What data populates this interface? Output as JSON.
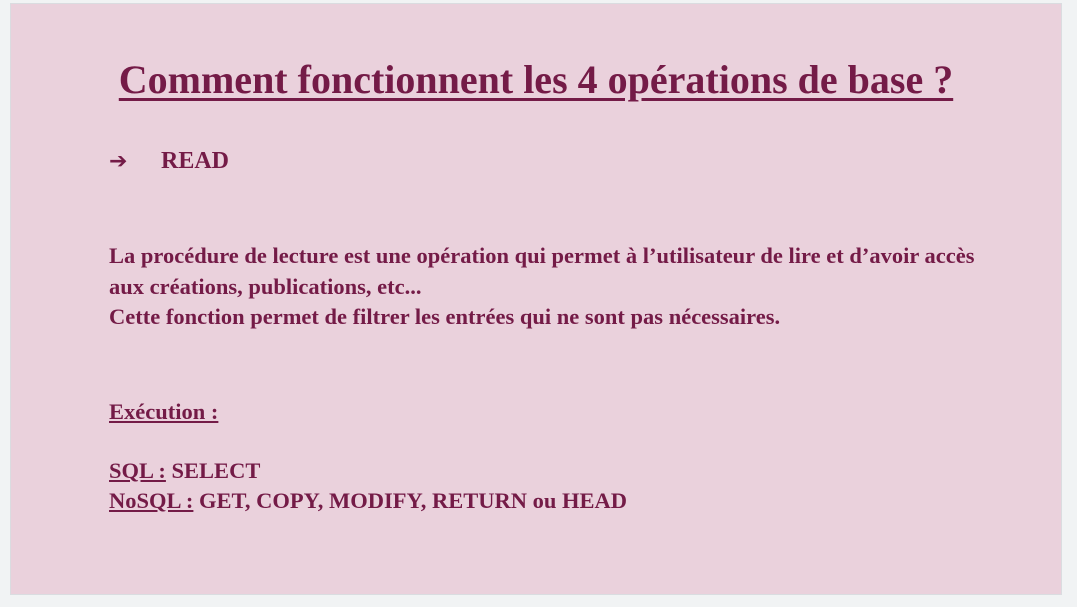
{
  "slide": {
    "title": "Comment fonctionnent les 4 opérations de base ?",
    "bullet": {
      "arrow": "➔",
      "label": "READ"
    },
    "description": [
      "La procédure de lecture est une opération qui permet à l’utilisateur de lire et d’avoir accès aux créations, publications, etc...",
      "Cette fonction permet de filtrer les entrées qui ne sont pas nécessaires."
    ],
    "execution_label": "Exécution :",
    "sql": {
      "label": "SQL :",
      "value": " SELECT"
    },
    "nosql": {
      "label": "NoSQL :",
      "value": " GET, COPY, MODIFY, RETURN ou HEAD"
    }
  },
  "colors": {
    "slide_background": "#ead1dc",
    "text": "#741b47",
    "editor_background": "#f1f3f4"
  }
}
